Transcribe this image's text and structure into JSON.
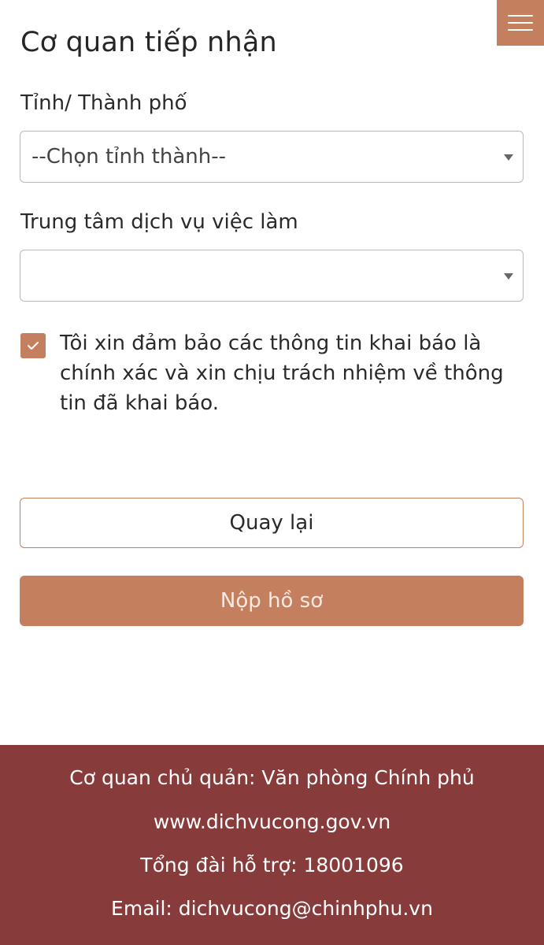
{
  "header": {
    "menu_icon": "hamburger-menu-icon",
    "title": "Cơ quan tiếp nhận"
  },
  "form": {
    "province": {
      "label": "Tỉnh/ Thành phố",
      "selected": "--Chọn tỉnh thành--"
    },
    "employment_center": {
      "label": "Trung tâm dịch vụ việc làm",
      "selected": ""
    },
    "confirmation": {
      "checked": true,
      "text": "Tôi xin đảm bảo các thông tin khai báo là chính xác và xin chịu trách nhiệm về thông tin đã khai báo."
    },
    "back_label": "Quay lại",
    "submit_label": "Nộp hồ sơ"
  },
  "footer": {
    "agency": "Cơ quan chủ quản: Văn phòng Chính phủ",
    "website": "www.dichvucong.gov.vn",
    "hotline": "Tổng đài hỗ trợ: 18001096",
    "email": "Email: dichvucong@chinhphu.vn"
  },
  "colors": {
    "accent": "#c47f5f",
    "footer_bg": "#883b3b",
    "text": "#212121"
  }
}
